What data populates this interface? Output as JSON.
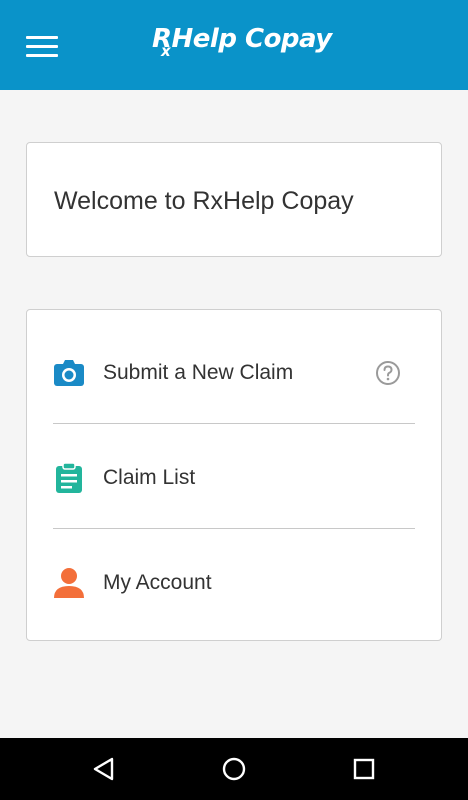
{
  "header": {
    "logo_text": "RHelp Copay",
    "logo_x": "x",
    "menu_icon": "hamburger-icon",
    "bg_color": "#0a93c9"
  },
  "welcome": {
    "text": "Welcome to RxHelp Copay"
  },
  "menu": {
    "items": [
      {
        "label": "Submit a New Claim",
        "icon": "camera-icon",
        "icon_color": "#1a8ac6",
        "help_icon": "help-circle-icon"
      },
      {
        "label": "Claim List",
        "icon": "clipboard-icon",
        "icon_color": "#22b59c"
      },
      {
        "label": "My Account",
        "icon": "person-icon",
        "icon_color": "#f36f3a"
      }
    ]
  },
  "nav": {
    "back_icon": "back-triangle-icon",
    "home_icon": "home-circle-icon",
    "recents_icon": "recents-square-icon"
  }
}
